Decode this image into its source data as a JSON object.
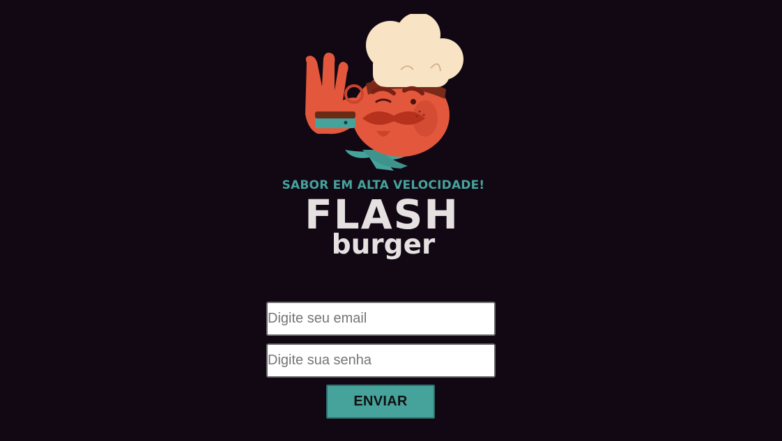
{
  "brand": {
    "tagline": "SABOR EM ALTA VELOCIDADE!",
    "name_main": "FLASH",
    "name_sub": "burger",
    "mascot": "chef-mascot-icon"
  },
  "login": {
    "email_placeholder": "Digite seu email",
    "password_placeholder": "Digite sua senha",
    "submit_label": "ENVIAR"
  },
  "colors": {
    "background": "#110814",
    "accent": "#46a39c",
    "logo_text": "#e5e1e1",
    "mascot_skin": "#e3583c",
    "chef_hat": "#f8e3c4"
  }
}
